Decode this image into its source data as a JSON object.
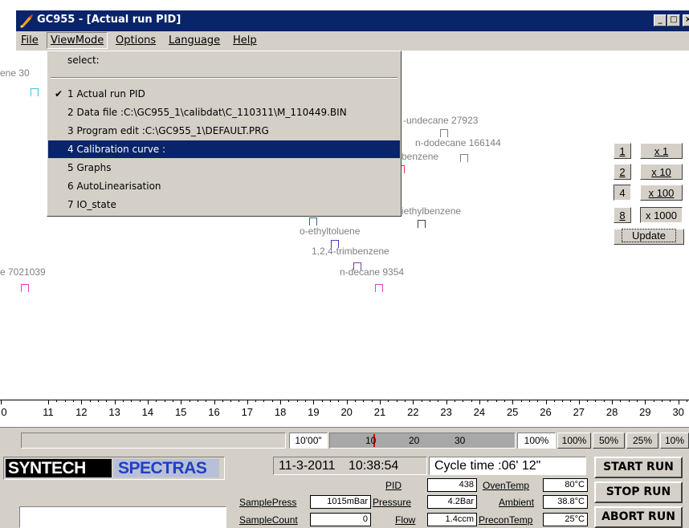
{
  "window": {
    "title": "GC955 - [Actual run PID]",
    "caption_buttons": [
      "minimize-icon",
      "maximize-icon",
      "close-icon"
    ]
  },
  "menubar": {
    "items": [
      "File",
      "ViewMode",
      "Options",
      "Language",
      "Help"
    ],
    "active": "ViewMode"
  },
  "viewmode_menu": {
    "header": "select:",
    "items": [
      {
        "label": "1 Actual run PID",
        "checked": true
      },
      {
        "label": "2 Data file :C:\\GC955_1\\calibdat\\C_110311\\M_110449.BIN"
      },
      {
        "label": "3 Program edit :C:\\GC955_1\\DEFAULT.PRG"
      },
      {
        "label": "4 Calibration curve :",
        "highlighted": true
      },
      {
        "label": "5 Graphs"
      },
      {
        "label": "6 AutoLinearisation"
      },
      {
        "label": "7 IO_state"
      }
    ]
  },
  "peaks": [
    {
      "label": "ene 30",
      "color": "#40c0e0"
    },
    {
      "label": "-undecane 27923",
      "color": "#808080"
    },
    {
      "label": "n-dodecane 166144",
      "color": "#808080"
    },
    {
      "label": "benzene",
      "color": "#808080"
    },
    {
      "label": "iethylbenzene",
      "color": "#404040"
    },
    {
      "label": "o-ethyltoluene",
      "color": "#3060a0"
    },
    {
      "label": "1,2,4-trimbenzene",
      "color": "#4040c0"
    },
    {
      "label": "n-decane 9354",
      "color": "#8040a0"
    },
    {
      "label": "e 7021039",
      "color": "#e040c0"
    }
  ],
  "scale_panel": {
    "channels": [
      "1",
      "2",
      "4",
      "8"
    ],
    "multipliers": [
      "x 1",
      "x 10",
      "x 100",
      "x 1000"
    ],
    "update_label": "Update"
  },
  "time_axis": {
    "ticks": [
      "0",
      "11",
      "12",
      "13",
      "14",
      "15",
      "16",
      "17",
      "18",
      "19",
      "20",
      "21",
      "22",
      "23",
      "24",
      "25",
      "26",
      "27",
      "28",
      "29",
      "30"
    ]
  },
  "progress": {
    "time_label": "10'00\"",
    "scale_labels": [
      "10",
      "20",
      "30"
    ],
    "percent": "100%",
    "zoom_options": [
      "100%",
      "50%",
      "25%",
      "10%"
    ]
  },
  "brand": {
    "syntech": "SYNTECH",
    "spectras": "SPECTRAS"
  },
  "clock": {
    "date": "11-3-2011",
    "time": "10:38:54",
    "cycle_time": "Cycle time :06' 12\""
  },
  "readings": {
    "pid_label": "PID",
    "pid_value": "438",
    "oven_label": "OvenTemp",
    "oven_value": "80°C",
    "samplepress_label": "SamplePress",
    "samplepress_value": "1015mBar",
    "pressure_label": "Pressure",
    "pressure_value": "4.2Bar",
    "ambient_label": "Ambient",
    "ambient_value": "38.8°C",
    "samplecount_label": "SampleCount",
    "samplecount_value": "0",
    "flow_label": "Flow",
    "flow_value": "1.4ccm",
    "precon_label": "PreconTemp",
    "precon_value": "25°C"
  },
  "actions": {
    "start": "START RUN",
    "stop": "STOP RUN",
    "abort": "ABORT RUN"
  }
}
